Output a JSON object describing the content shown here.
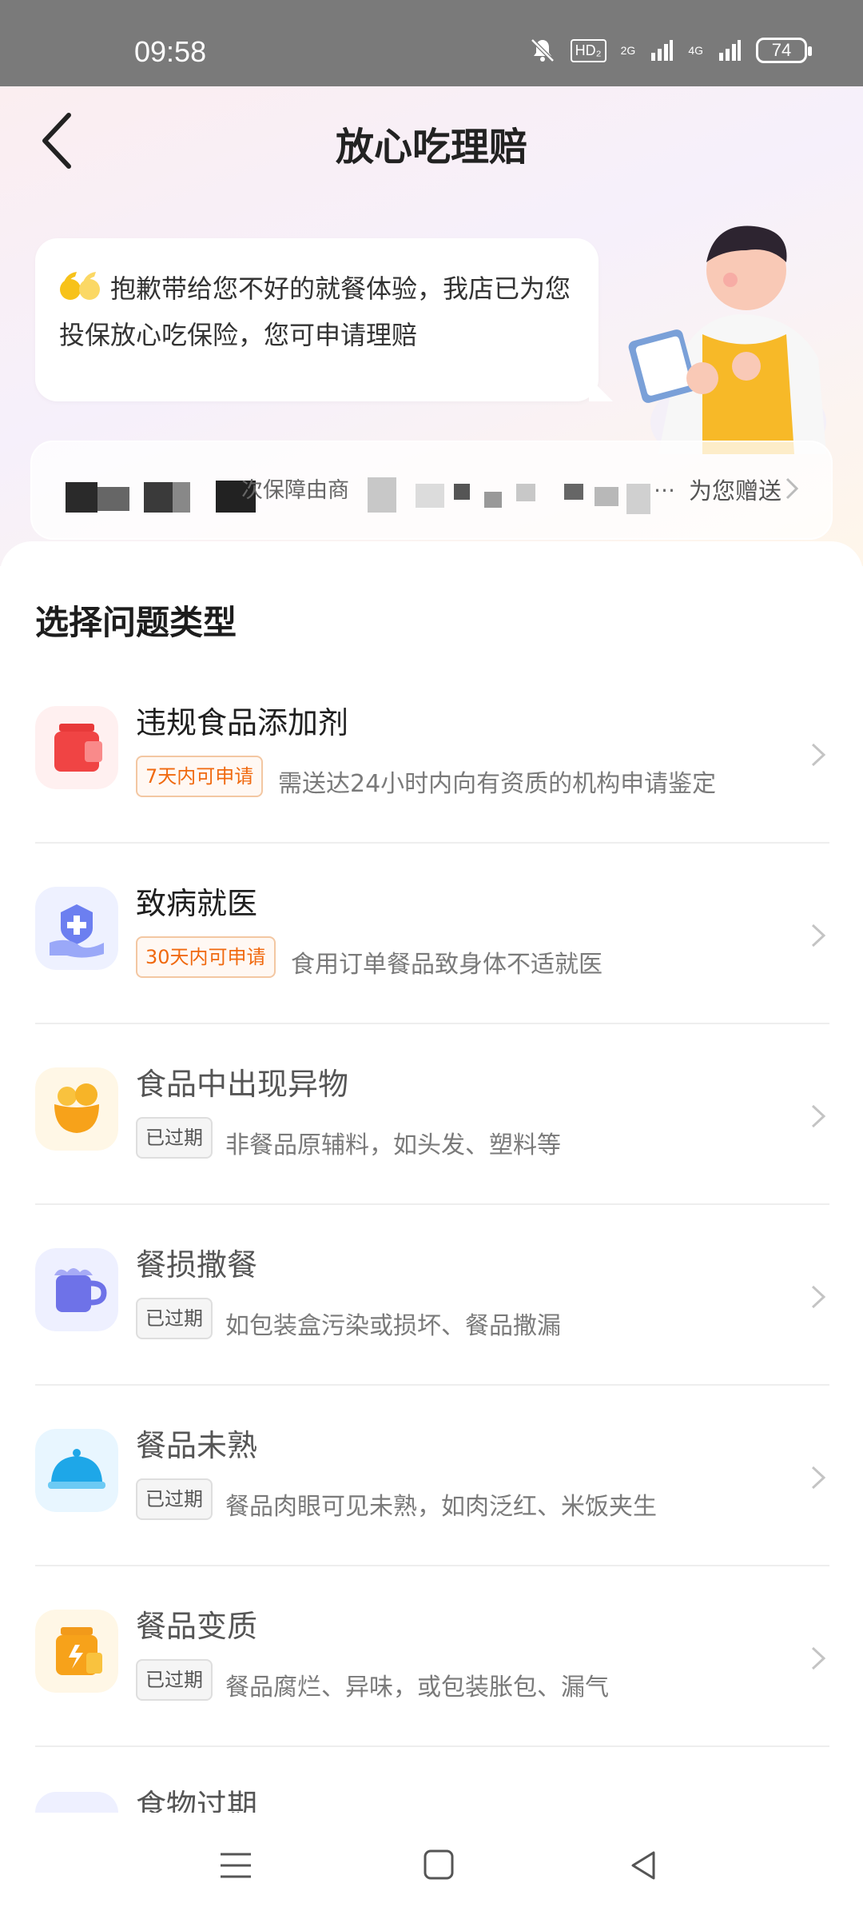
{
  "status_bar": {
    "time": "09:58",
    "hd_label": "HD₂",
    "net_2g": "2G",
    "net_4g": "4G",
    "battery": "74"
  },
  "header": {
    "title": "放心吃理赔"
  },
  "message": {
    "text": "抱歉带给您不好的就餐体验，我店已为您投保放心吃保险，您可申请理赔"
  },
  "insurance_bar": {
    "middle_text": "次保障由商",
    "ellipsis": "…",
    "gift_label": "为您赠送"
  },
  "section": {
    "title": "选择问题类型"
  },
  "items": [
    {
      "label": "违规食品添加剂",
      "badge": "7天内可申请",
      "status": "active",
      "desc": "需送达24小时内向有资质的机构申请鉴定",
      "icon": "jar-icon"
    },
    {
      "label": "致病就医",
      "badge": "30天内可申请",
      "status": "active",
      "desc": "食用订单餐品致身体不适就医",
      "icon": "medical-hand-icon"
    },
    {
      "label": "食品中出现异物",
      "badge": "已过期",
      "status": "expired",
      "desc": "非餐品原辅料，如头发、塑料等",
      "icon": "foreign-object-icon"
    },
    {
      "label": "餐损撒餐",
      "badge": "已过期",
      "status": "expired",
      "desc": "如包装盒污染或损坏、餐品撒漏",
      "icon": "spilled-cup-icon"
    },
    {
      "label": "餐品未熟",
      "badge": "已过期",
      "status": "expired",
      "desc": "餐品肉眼可见未熟，如肉泛红、米饭夹生",
      "icon": "food-cover-icon"
    },
    {
      "label": "餐品变质",
      "badge": "已过期",
      "status": "expired",
      "desc": "餐品腐烂、异味，或包装胀包、漏气",
      "icon": "spoiled-jar-icon"
    },
    {
      "label": "食物过期",
      "icon": "expired-food-icon"
    }
  ],
  "colors": {
    "accent_orange": "#f0690f",
    "status_bar": "#7a7a7a"
  }
}
